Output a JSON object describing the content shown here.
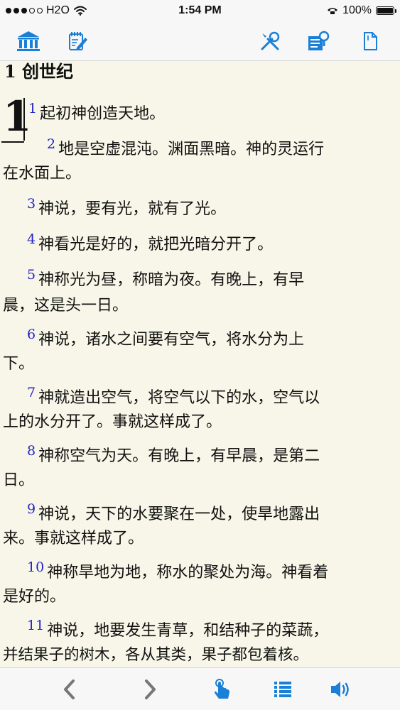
{
  "status_bar": {
    "carrier": "H2O",
    "time": "1:54 PM",
    "battery": "100%",
    "signal_dots_filled": 3,
    "signal_dots_total": 5
  },
  "toolbar": {
    "icons": [
      "bible-library-icon",
      "notes-edit-icon",
      "tools-icon",
      "search-list-icon",
      "bookmark-page-icon"
    ],
    "accent": "#1a7fd6"
  },
  "reader": {
    "book_title": "1 创世纪",
    "chapter_number": "1",
    "verse_color": "#2323c8",
    "verses": [
      {
        "num": "1",
        "lines": [
          "起初神创造天地。"
        ]
      },
      {
        "num": "2",
        "lines": [
          "地是空虚混沌。渊面黑暗。神的灵运行",
          "在水面上。"
        ]
      },
      {
        "num": "3",
        "lines": [
          "神说，要有光，就有了光。"
        ]
      },
      {
        "num": "4",
        "lines": [
          "神看光是好的，就把光暗分开了。"
        ]
      },
      {
        "num": "5",
        "lines": [
          "神称光为昼，称暗为夜。有晚上，有早",
          "晨，这是头一日。"
        ]
      },
      {
        "num": "6",
        "lines": [
          "神说，诸水之间要有空气，将水分为上",
          "下。"
        ]
      },
      {
        "num": "7",
        "lines": [
          "神就造出空气，将空气以下的水，空气以",
          "上的水分开了。事就这样成了。"
        ]
      },
      {
        "num": "8",
        "lines": [
          "神称空气为天。有晚上，有早晨，是第二",
          "日。"
        ]
      },
      {
        "num": "9",
        "lines": [
          "神说，天下的水要聚在一处，使旱地露出",
          "来。事就这样成了。"
        ]
      },
      {
        "num": "10",
        "lines": [
          "神称旱地为地，称水的聚处为海。神看着",
          "是好的。"
        ]
      },
      {
        "num": "11",
        "lines": [
          "神说，地要发生青草，和结种子的菜蔬，",
          "并结果子的树木，各从其类，果子都包着核。"
        ]
      }
    ]
  },
  "bottom_bar": {
    "icons": [
      "chevron-left-icon",
      "chevron-right-icon",
      "tap-hand-icon",
      "list-icon",
      "speaker-icon"
    ]
  }
}
